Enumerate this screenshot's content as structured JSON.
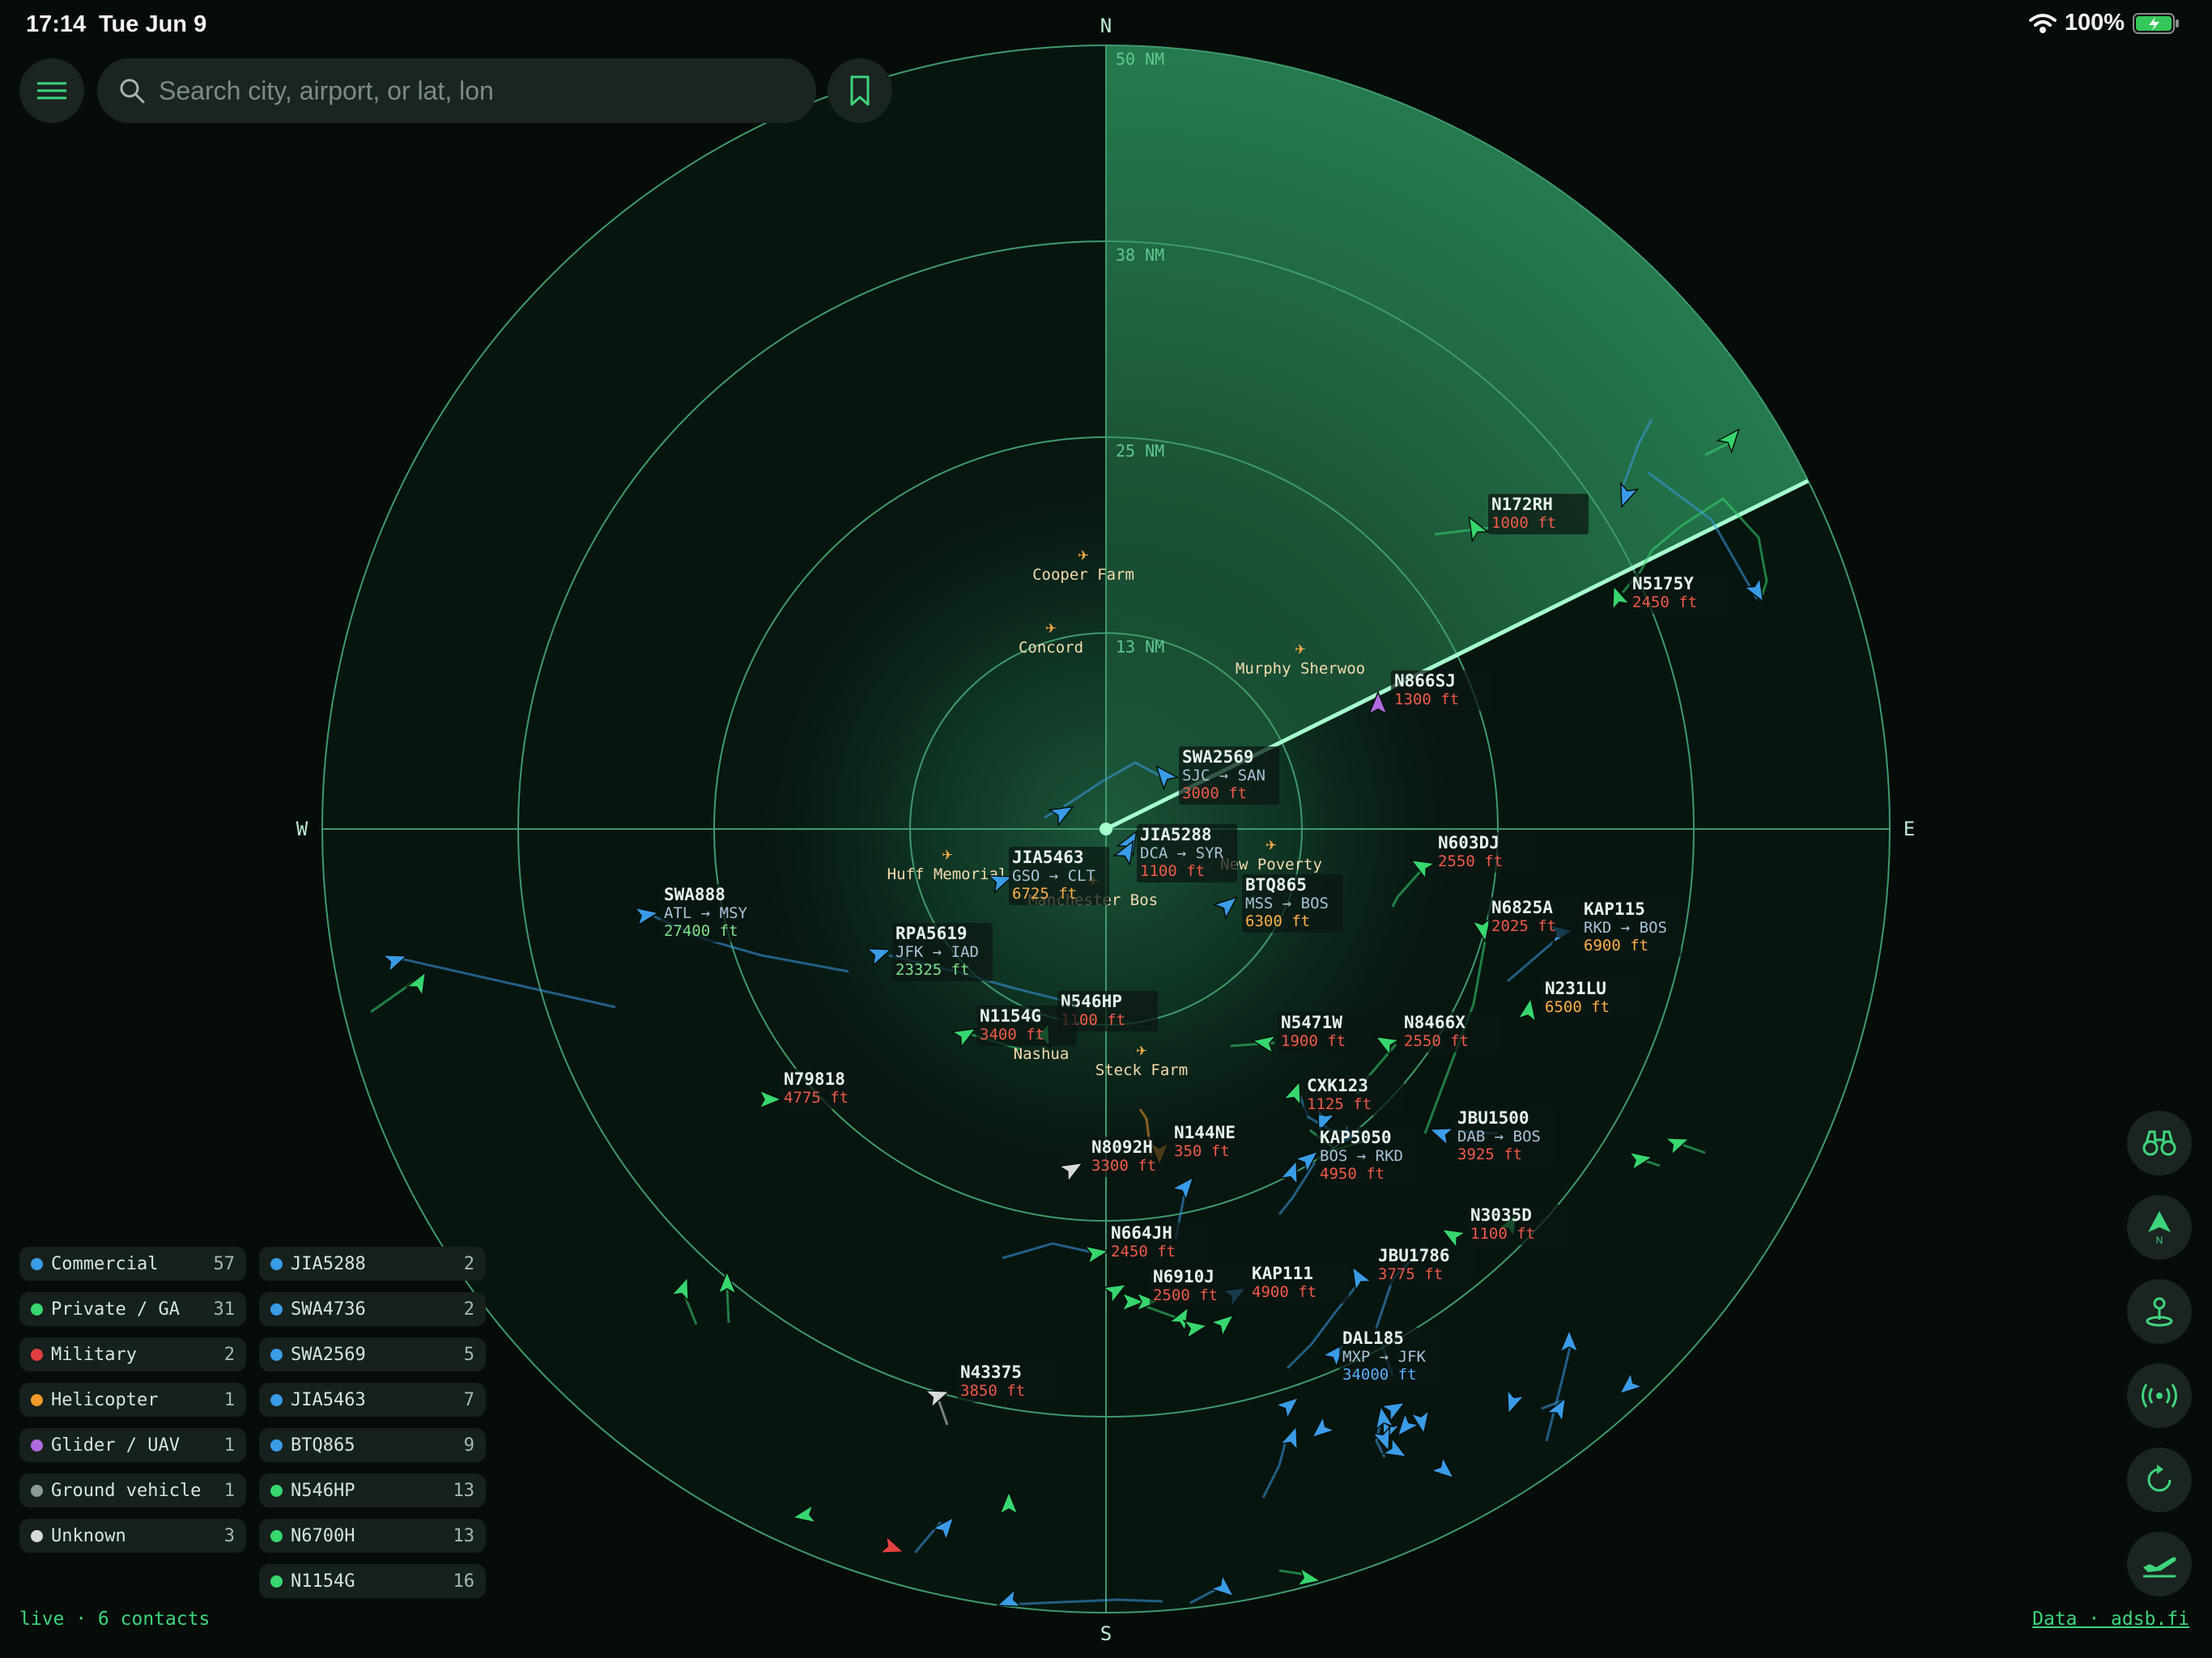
{
  "status_bar": {
    "time": "17:14",
    "date": "Tue Jun 9",
    "battery": "100%"
  },
  "search": {
    "placeholder": "Search city, airport, or lat, lon"
  },
  "cardinals": {
    "n": "N",
    "s": "S",
    "e": "E",
    "w": "W"
  },
  "rings": [
    "13 NM",
    "25 NM",
    "38 NM",
    "50 NM"
  ],
  "airports": [
    {
      "name": "Cooper Farm"
    },
    {
      "name": "Concord"
    },
    {
      "name": "Murphy Sherwoo"
    },
    {
      "name": "Huff Memorial"
    },
    {
      "name": "Manchester Bos"
    },
    {
      "name": "New Poverty"
    },
    {
      "name": "Nashua"
    },
    {
      "name": "Steck Farm"
    }
  ],
  "colors": {
    "commercial": "#3a9be6",
    "private": "#37d66f",
    "military": "#e24040",
    "helicopter": "#ef9a2a",
    "glider": "#b06ae0",
    "ground": "#8e9a95",
    "unknown": "#d8dcd9",
    "radar_line": "#3f9a6e",
    "sweep": "#a6ffcf",
    "alt_low": "#ef5a4a",
    "alt_mid": "#ffb04a",
    "alt_high": "#7fe08a",
    "alt_cruise": "#5ab0ff"
  },
  "aircraft": [
    {
      "callsign": "N172RH",
      "alt": "1000 ft",
      "alt_color": "#ef5a4a",
      "type": "private"
    },
    {
      "callsign": "N5175Y",
      "alt": "2450 ft",
      "alt_color": "#ef5a4a",
      "type": "private"
    },
    {
      "callsign": "N866SJ",
      "alt": "1300 ft",
      "alt_color": "#ef5a4a",
      "type": "glider"
    },
    {
      "callsign": "SWA2569",
      "route": "SJC → SAN",
      "alt": "3000 ft",
      "alt_color": "#ef5a4a",
      "type": "commercial"
    },
    {
      "callsign": "JIA5288",
      "route": "DCA → SYR",
      "alt": "1100 ft",
      "alt_color": "#ef5a4a",
      "type": "commercial"
    },
    {
      "callsign": "JIA5463",
      "route": "GSO → CLT",
      "alt": "6725 ft",
      "alt_color": "#ffb04a",
      "type": "commercial"
    },
    {
      "callsign": "BTQ865",
      "route": "MSS → BOS",
      "alt": "6300 ft",
      "alt_color": "#ffb04a",
      "type": "commercial"
    },
    {
      "callsign": "N603DJ",
      "alt": "2550 ft",
      "alt_color": "#ef5a4a",
      "type": "private"
    },
    {
      "callsign": "N6825A",
      "alt": "2025 ft",
      "alt_color": "#ef5a4a",
      "type": "private"
    },
    {
      "callsign": "KAP115",
      "route": "RKD → BOS",
      "alt": "6900 ft",
      "alt_color": "#ffb04a",
      "type": "commercial"
    },
    {
      "callsign": "SWA888",
      "route": "ATL → MSY",
      "alt": "27400 ft",
      "alt_color": "#7fe08a",
      "type": "commercial"
    },
    {
      "callsign": "RPA5619",
      "route": "JFK → IAD",
      "alt": "23325 ft",
      "alt_color": "#7fe08a",
      "type": "commercial"
    },
    {
      "callsign": "N231LU",
      "alt": "6500 ft",
      "alt_color": "#ffb04a",
      "type": "private"
    },
    {
      "callsign": "N546HP",
      "alt": "1100 ft",
      "alt_color": "#ef5a4a",
      "type": "private"
    },
    {
      "callsign": "N1154G",
      "alt": "3400 ft",
      "alt_color": "#ef5a4a",
      "type": "private"
    },
    {
      "callsign": "N5471W",
      "alt": "1900 ft",
      "alt_color": "#ef5a4a",
      "type": "private"
    },
    {
      "callsign": "N8466X",
      "alt": "2550 ft",
      "alt_color": "#ef5a4a",
      "type": "private"
    },
    {
      "callsign": "N79818",
      "alt": "4775 ft",
      "alt_color": "#ef5a4a",
      "type": "private"
    },
    {
      "callsign": "CXK123",
      "alt": "1125 ft",
      "alt_color": "#ef5a4a",
      "type": "private"
    },
    {
      "callsign": "JBU1500",
      "route": "DAB → BOS",
      "alt": "3925 ft",
      "alt_color": "#ef5a4a",
      "type": "commercial"
    },
    {
      "callsign": "N8092H",
      "alt": "3300 ft",
      "alt_color": "#ef5a4a",
      "type": "unknown"
    },
    {
      "callsign": "N144NE",
      "alt": "350 ft",
      "alt_color": "#ef5a4a",
      "type": "helicopter"
    },
    {
      "callsign": "KAP5050",
      "route": "BOS → RKD",
      "alt": "4950 ft",
      "alt_color": "#ef5a4a",
      "type": "commercial"
    },
    {
      "callsign": "N3035D",
      "alt": "1100 ft",
      "alt_color": "#ef5a4a",
      "type": "private"
    },
    {
      "callsign": "N664JH",
      "alt": "2450 ft",
      "alt_color": "#ef5a4a",
      "type": "private"
    },
    {
      "callsign": "JBU1786",
      "alt": "3775 ft",
      "alt_color": "#ef5a4a",
      "type": "commercial"
    },
    {
      "callsign": "N6910J",
      "alt": "2500 ft",
      "alt_color": "#ef5a4a",
      "type": "private"
    },
    {
      "callsign": "KAP111",
      "alt": "4900 ft",
      "alt_color": "#ef5a4a",
      "type": "commercial"
    },
    {
      "callsign": "DAL185",
      "route": "MXP → JFK",
      "alt": "34000 ft",
      "alt_color": "#5ab0ff",
      "type": "commercial"
    },
    {
      "callsign": "N43375",
      "alt": "3850 ft",
      "alt_color": "#ef5a4a",
      "type": "unknown"
    }
  ],
  "categories": [
    {
      "label": "Commercial",
      "count": "57",
      "color": "#3a9be6"
    },
    {
      "label": "Private / GA",
      "count": "31",
      "color": "#37d66f"
    },
    {
      "label": "Military",
      "count": "2",
      "color": "#e24040"
    },
    {
      "label": "Helicopter",
      "count": "1",
      "color": "#ef9a2a"
    },
    {
      "label": "Glider / UAV",
      "count": "1",
      "color": "#b06ae0"
    },
    {
      "label": "Ground vehicle",
      "count": "1",
      "color": "#8e9a95"
    },
    {
      "label": "Unknown",
      "count": "3",
      "color": "#d8dcd9"
    }
  ],
  "tracked": [
    {
      "label": "JIA5288",
      "count": "2",
      "color": "#3a9be6"
    },
    {
      "label": "SWA4736",
      "count": "2",
      "color": "#3a9be6"
    },
    {
      "label": "SWA2569",
      "count": "5",
      "color": "#3a9be6"
    },
    {
      "label": "JIA5463",
      "count": "7",
      "color": "#3a9be6"
    },
    {
      "label": "BTQ865",
      "count": "9",
      "color": "#3a9be6"
    },
    {
      "label": "N546HP",
      "count": "13",
      "color": "#37d66f"
    },
    {
      "label": "N6700H",
      "count": "13",
      "color": "#37d66f"
    },
    {
      "label": "N1154G",
      "count": "16",
      "color": "#37d66f"
    }
  ],
  "footer": {
    "status": "live · 6 contacts",
    "source": "Data · adsb.fi"
  },
  "side_buttons": [
    "binoculars-icon",
    "north-arrow-icon",
    "location-pin-icon",
    "antenna-icon",
    "refresh-icon",
    "takeoff-icon"
  ]
}
